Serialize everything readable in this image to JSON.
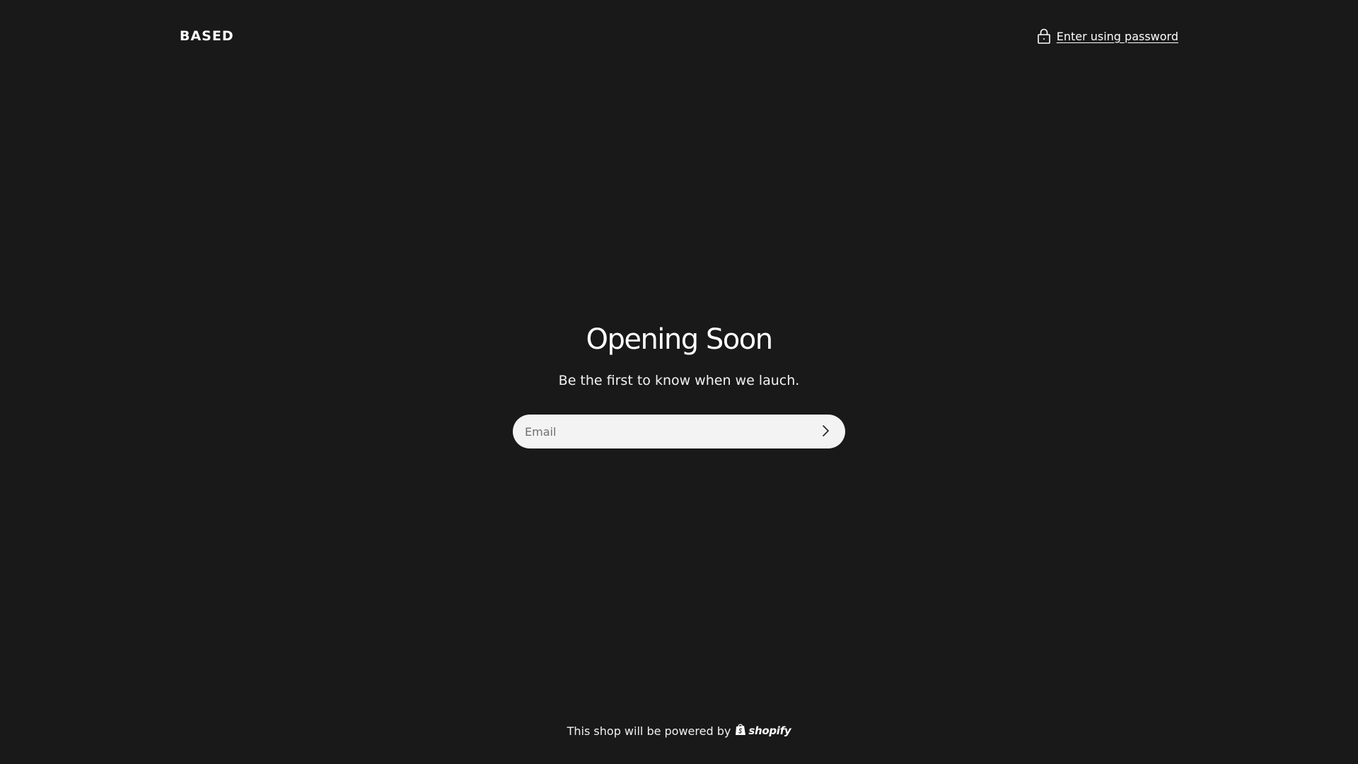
{
  "header": {
    "logo_text": "BASED",
    "password_link_label": "Enter using password",
    "lock_icon": "lock-icon"
  },
  "main": {
    "title": "Opening Soon",
    "subtitle": "Be the first to know when we lauch.",
    "email_input": {
      "value": "",
      "placeholder": "Email"
    },
    "submit_icon": "chevron-right-icon"
  },
  "footer": {
    "text": "This shop will be powered by",
    "brand": "shopify",
    "brand_icon": "shopify-bag-icon"
  },
  "colors": {
    "background": "#191919",
    "text": "#ffffff",
    "input_background": "#f3f3f3",
    "placeholder": "#6f6f6f"
  }
}
